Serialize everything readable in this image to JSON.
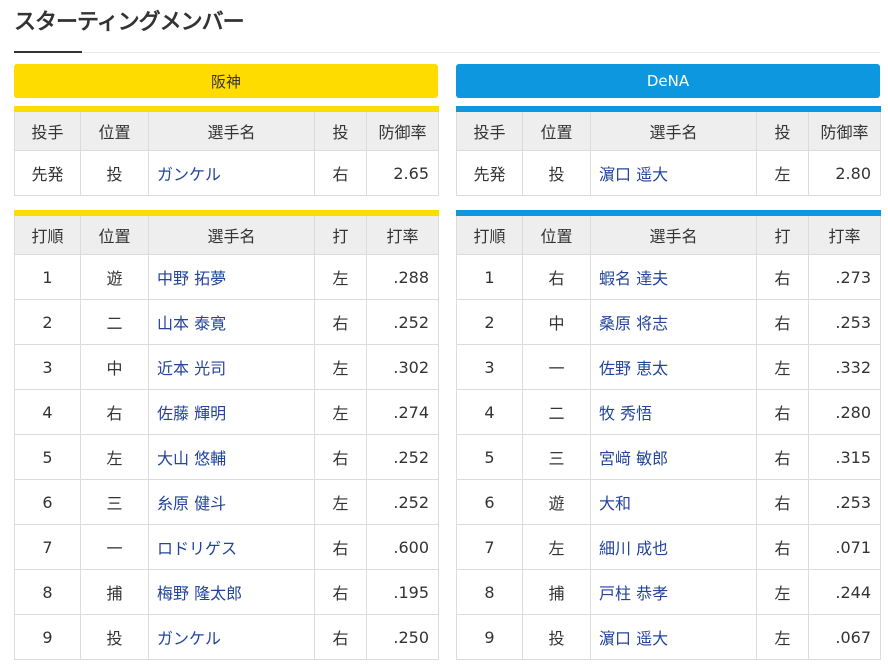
{
  "page": {
    "title": "スターティングメンバー"
  },
  "teams": {
    "home": {
      "name": "阪神",
      "color": "#ffdc00",
      "pitcher_headers": [
        "投手",
        "位置",
        "選手名",
        "投",
        "防御率"
      ],
      "pitcher": {
        "role": "先発",
        "position": "投",
        "name": "ガンケル",
        "throws": "右",
        "era": "2.65"
      },
      "batting_headers": [
        "打順",
        "位置",
        "選手名",
        "打",
        "打率"
      ],
      "lineup": [
        {
          "order": "1",
          "position": "遊",
          "name": "中野 拓夢",
          "bats": "左",
          "avg": ".288"
        },
        {
          "order": "2",
          "position": "二",
          "name": "山本 泰寛",
          "bats": "右",
          "avg": ".252"
        },
        {
          "order": "3",
          "position": "中",
          "name": "近本 光司",
          "bats": "左",
          "avg": ".302"
        },
        {
          "order": "4",
          "position": "右",
          "name": "佐藤 輝明",
          "bats": "左",
          "avg": ".274"
        },
        {
          "order": "5",
          "position": "左",
          "name": "大山 悠輔",
          "bats": "右",
          "avg": ".252"
        },
        {
          "order": "6",
          "position": "三",
          "name": "糸原 健斗",
          "bats": "左",
          "avg": ".252"
        },
        {
          "order": "7",
          "position": "一",
          "name": "ロドリゲス",
          "bats": "右",
          "avg": ".600"
        },
        {
          "order": "8",
          "position": "捕",
          "name": "梅野 隆太郎",
          "bats": "右",
          "avg": ".195"
        },
        {
          "order": "9",
          "position": "投",
          "name": "ガンケル",
          "bats": "右",
          "avg": ".250"
        }
      ]
    },
    "away": {
      "name": "DeNA",
      "color": "#0d97df",
      "pitcher_headers": [
        "投手",
        "位置",
        "選手名",
        "投",
        "防御率"
      ],
      "pitcher": {
        "role": "先発",
        "position": "投",
        "name": "濵口 遥大",
        "throws": "左",
        "era": "2.80"
      },
      "batting_headers": [
        "打順",
        "位置",
        "選手名",
        "打",
        "打率"
      ],
      "lineup": [
        {
          "order": "1",
          "position": "右",
          "name": "蝦名 達夫",
          "bats": "右",
          "avg": ".273"
        },
        {
          "order": "2",
          "position": "中",
          "name": "桑原 将志",
          "bats": "右",
          "avg": ".253"
        },
        {
          "order": "3",
          "position": "一",
          "name": "佐野 恵太",
          "bats": "左",
          "avg": ".332"
        },
        {
          "order": "4",
          "position": "二",
          "name": "牧 秀悟",
          "bats": "右",
          "avg": ".280"
        },
        {
          "order": "5",
          "position": "三",
          "name": "宮﨑 敏郎",
          "bats": "右",
          "avg": ".315"
        },
        {
          "order": "6",
          "position": "遊",
          "name": "大和",
          "bats": "右",
          "avg": ".253"
        },
        {
          "order": "7",
          "position": "左",
          "name": "細川 成也",
          "bats": "右",
          "avg": ".071"
        },
        {
          "order": "8",
          "position": "捕",
          "name": "戸柱 恭孝",
          "bats": "左",
          "avg": ".244"
        },
        {
          "order": "9",
          "position": "投",
          "name": "濵口 遥大",
          "bats": "左",
          "avg": ".067"
        }
      ]
    }
  }
}
